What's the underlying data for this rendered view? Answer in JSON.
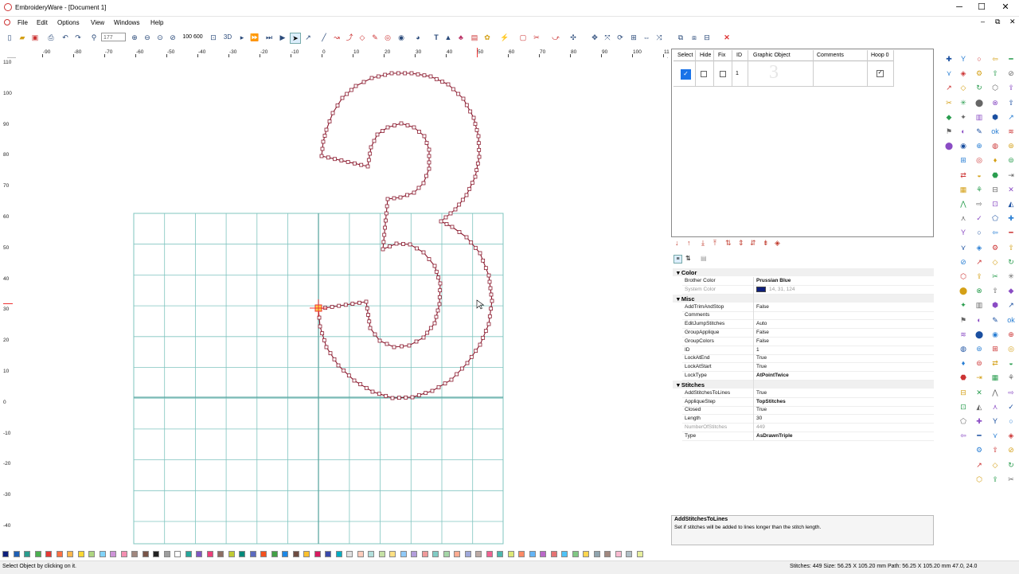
{
  "window": {
    "title": "EmbroideryWare - [Document 1]",
    "minimize": "─",
    "maximize": "☐",
    "close": "✕",
    "mdi_minimize": "–",
    "mdi_restore": "⧉",
    "mdi_close": "✕"
  },
  "menu": [
    "File",
    "Edit",
    "Options",
    "View",
    "Windows",
    "Help"
  ],
  "toolbar": {
    "zoom_value": "177",
    "zoom_fit_label": "100 600",
    "view_3d_label": "3D"
  },
  "rulers": {
    "horizontal": [
      "-90",
      "-80",
      "-70",
      "-60",
      "-50",
      "-40",
      "-30",
      "-20",
      "-10",
      "0",
      "10",
      "20",
      "30",
      "40",
      "50",
      "60",
      "70",
      "80",
      "90",
      "100",
      "11"
    ],
    "vertical": [
      "110",
      "100",
      "90",
      "80",
      "70",
      "60",
      "50",
      "40",
      "30",
      "20",
      "10",
      "0",
      "-10",
      "-20",
      "-30",
      "-40"
    ]
  },
  "object_list": {
    "columns": [
      "Select",
      "Hide",
      "Fix",
      "ID",
      "Graphic Object",
      "Comments",
      "Hoop 0"
    ],
    "rows": [
      {
        "select": true,
        "hide": false,
        "fix": false,
        "id": "1",
        "graphic": "3",
        "comments": "",
        "hoop": true
      }
    ]
  },
  "properties": {
    "categories": [
      {
        "name": "Color",
        "items": [
          {
            "name": "Brother Color",
            "value": "Prussian Blue",
            "bold": true
          },
          {
            "name": "System Color",
            "value": "14, 31, 124",
            "dim": true,
            "swatch": "#0e1f7c"
          }
        ]
      },
      {
        "name": "Misc",
        "items": [
          {
            "name": "AddTrimAndStop",
            "value": "False"
          },
          {
            "name": "Comments",
            "value": ""
          },
          {
            "name": "EditJumpStitches",
            "value": "Auto"
          },
          {
            "name": "GroupApplique",
            "value": "False"
          },
          {
            "name": "GroupColors",
            "value": "False"
          },
          {
            "name": "ID",
            "value": "1"
          },
          {
            "name": "LockAtEnd",
            "value": "True"
          },
          {
            "name": "LockAtStart",
            "value": "True"
          },
          {
            "name": "LockType",
            "value": "AtPointTwice",
            "bold": true
          }
        ]
      },
      {
        "name": "Stitches",
        "items": [
          {
            "name": "AddStitchesToLines",
            "value": "True"
          },
          {
            "name": "AppliqueStep",
            "value": "TopStitches",
            "bold": true
          },
          {
            "name": "Closed",
            "value": "True"
          },
          {
            "name": "Length",
            "value": "30"
          },
          {
            "name": "NumberOfStitches",
            "value": "449",
            "dim": true
          },
          {
            "name": "Type",
            "value": "AsDrawnTriple",
            "bold": true
          }
        ]
      }
    ],
    "description_title": "AddStitchesToLines",
    "description_text": "Set if stitches will be added to lines longer than the stitch length."
  },
  "status": {
    "hint": "Select Object by clicking on it.",
    "info": "Stitches: 449 Size: 56.25 X 105.20  mm   Path: 56.25 X 105.20  mm    47.0, 24.0"
  },
  "colors": {
    "stitch_line": "#8b1a2e",
    "grid": "#7fc4bf",
    "accent": "#1a73e8",
    "palette": [
      "#0e1f7c",
      "#1e5fb4",
      "#2a9d8f",
      "#4caf50",
      "#e53935",
      "#ff7043",
      "#ffb74d",
      "#fdd835",
      "#aed581",
      "#81d4fa",
      "#ce93d8",
      "#f48fb1",
      "#a1887f",
      "#795548",
      "#212121",
      "#9e9e9e",
      "#ffffff",
      "#26a69a",
      "#7e57c2",
      "#ec407a",
      "#8d6e63",
      "#c0ca33",
      "#00897b",
      "#5c6bc0",
      "#f4511e",
      "#43a047",
      "#1e88e5",
      "#6d4c41",
      "#fbc02d",
      "#d81b60",
      "#3949ab",
      "#00acc1",
      "#e0e0e0",
      "#ffccbc",
      "#b2dfdb",
      "#c5e1a5",
      "#ffe082",
      "#90caf9",
      "#b39ddb",
      "#ef9a9a",
      "#80cbc4",
      "#a5d6a7",
      "#ffab91",
      "#9fa8da",
      "#bcaaa4",
      "#f06292",
      "#4db6ac",
      "#dce775",
      "#ff8a65",
      "#64b5f6",
      "#ba68c8",
      "#e57373",
      "#4fc3f7",
      "#81c784",
      "#ffd54f",
      "#90a4ae",
      "#a1887f",
      "#f8bbd0",
      "#b0bec5",
      "#e6ee9c"
    ]
  }
}
